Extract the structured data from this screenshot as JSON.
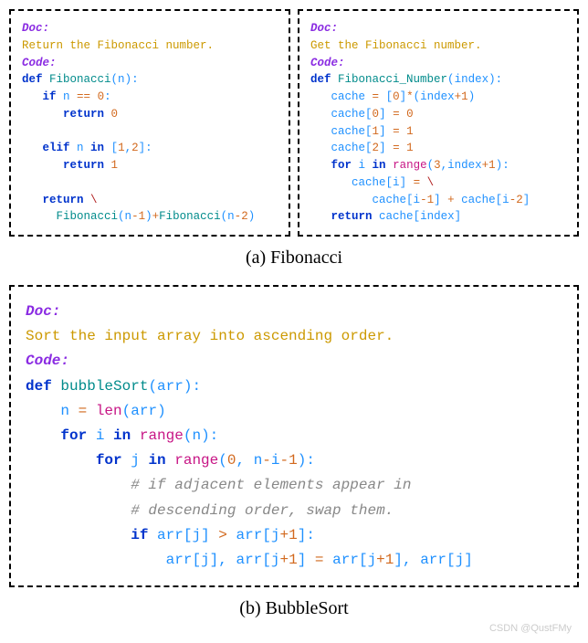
{
  "top": {
    "left": {
      "docLabel": "Doc:",
      "docText": "Return the Fibonacci number.",
      "codeLabel": "Code:",
      "l1_def": "def",
      "l1_fn": " Fibonacci",
      "l1_paren_open": "(",
      "l1_arg": "n",
      "l1_paren_close": "):",
      "l2_if": "if",
      "l2_var": " n ",
      "l2_eq": "==",
      "l2_sp": " ",
      "l2_zero": "0",
      "l2_colon": ":",
      "l3_ret": "return",
      "l3_sp": " ",
      "l3_zero": "0",
      "l4_elif": "elif",
      "l4_var": " n ",
      "l4_in": "in",
      "l4_sp": " ",
      "l4_lb": "[",
      "l4_one": "1",
      "l4_comma": ",",
      "l4_two": "2",
      "l4_rb": "]:",
      "l5_ret": "return",
      "l5_sp": " ",
      "l5_one": "1",
      "l6_ret": "return",
      "l6_sp": " ",
      "l6_bs": "\\",
      "l7_fn1": "Fibonacci",
      "l7_p1o": "(",
      "l7_v1": "n",
      "l7_m1": "-",
      "l7_n1": "1",
      "l7_p1c": ")",
      "l7_plus": "+",
      "l7_fn2": "Fibonacci",
      "l7_p2o": "(",
      "l7_v2": "n",
      "l7_m2": "-",
      "l7_n2": "2",
      "l7_p2c": ")"
    },
    "right": {
      "docLabel": "Doc:",
      "docText": "Get the Fibonacci number.",
      "codeLabel": "Code:",
      "l1_def": "def",
      "l1_fn": " Fibonacci_Number",
      "l1_po": "(",
      "l1_arg": "index",
      "l1_pc": "):",
      "l2_var": "cache ",
      "l2_eq": "=",
      "l2_sp": " ",
      "l2_lb": "[",
      "l2_zero": "0",
      "l2_rb": "]",
      "l2_star": "*",
      "l2_po": "(",
      "l2_idx": "index",
      "l2_plus": "+",
      "l2_one": "1",
      "l2_pc": ")",
      "l3_var": "cache",
      "l3_lb": "[",
      "l3_zero": "0",
      "l3_rb": "] ",
      "l3_eq": "=",
      "l3_sp": " ",
      "l3_val": "0",
      "l4_var": "cache",
      "l4_lb": "[",
      "l4_one": "1",
      "l4_rb": "] ",
      "l4_eq": "=",
      "l4_sp": " ",
      "l4_val": "1",
      "l5_var": "cache",
      "l5_lb": "[",
      "l5_two": "2",
      "l5_rb": "] ",
      "l5_eq": "=",
      "l5_sp": " ",
      "l5_val": "1",
      "l6_for": "for",
      "l6_i": " i ",
      "l6_in": "in",
      "l6_sp": " ",
      "l6_range": "range",
      "l6_po": "(",
      "l6_three": "3",
      "l6_comma": ",",
      "l6_idx": "index",
      "l6_plus": "+",
      "l6_one": "1",
      "l6_pc": "):",
      "l7_var": "cache",
      "l7_lb": "[",
      "l7_i": "i",
      "l7_rb": "] ",
      "l7_eq": "=",
      "l7_sp": " ",
      "l7_bs": "\\",
      "l8_v1": "cache",
      "l8_lb1": "[",
      "l8_i1": "i",
      "l8_m1": "-",
      "l8_n1": "1",
      "l8_rb1": "] ",
      "l8_plus": "+",
      "l8_sp": " ",
      "l8_v2": "cache",
      "l8_lb2": "[",
      "l8_i2": "i",
      "l8_m2": "-",
      "l8_n2": "2",
      "l8_rb2": "]",
      "l9_ret": "return",
      "l9_sp": " ",
      "l9_var": "cache",
      "l9_lb": "[",
      "l9_idx": "index",
      "l9_rb": "]"
    }
  },
  "captionA": "(a) Fibonacci",
  "bottom": {
    "docLabel": "Doc:",
    "docText": "Sort the input array into ascending order.",
    "codeLabel": "Code:",
    "l1_def": "def",
    "l1_fn": " bubbleSort",
    "l1_po": "(",
    "l1_arg": "arr",
    "l1_pc": "):",
    "l2_var": "n ",
    "l2_eq": "=",
    "l2_sp": " ",
    "l2_len": "len",
    "l2_po": "(",
    "l2_arr": "arr",
    "l2_pc": ")",
    "l3_for": "for",
    "l3_i": " i ",
    "l3_in": "in",
    "l3_sp": " ",
    "l3_range": "range",
    "l3_po": "(",
    "l3_n": "n",
    "l3_pc": "):",
    "l4_for": "for",
    "l4_j": " j ",
    "l4_in": "in",
    "l4_sp": " ",
    "l4_range": "range",
    "l4_po": "(",
    "l4_zero": "0",
    "l4_comma": ", ",
    "l4_n": "n",
    "l4_m1": "-",
    "l4_i": "i",
    "l4_m2": "-",
    "l4_one": "1",
    "l4_pc": "):",
    "l5_cmt": "# if adjacent elements appear in",
    "l6_cmt": "# descending order, swap them.",
    "l7_if": "if",
    "l7_sp": " ",
    "l7_a1": "arr",
    "l7_lb1": "[",
    "l7_j1": "j",
    "l7_rb1": "] ",
    "l7_gt": ">",
    "l7_sp2": " ",
    "l7_a2": "arr",
    "l7_lb2": "[",
    "l7_j2": "j",
    "l7_plus": "+",
    "l7_one": "1",
    "l7_rb2": "]:",
    "l8_a1": "arr",
    "l8_lb1": "[",
    "l8_j1": "j",
    "l8_rb1": "], ",
    "l8_a2": "arr",
    "l8_lb2": "[",
    "l8_j2": "j",
    "l8_plus2": "+",
    "l8_one2": "1",
    "l8_rb2": "] ",
    "l8_eq": "=",
    "l8_sp": " ",
    "l8_a3": "arr",
    "l8_lb3": "[",
    "l8_j3": "j",
    "l8_plus3": "+",
    "l8_one3": "1",
    "l8_rb3": "], ",
    "l8_a4": "arr",
    "l8_lb4": "[",
    "l8_j4": "j",
    "l8_rb4": "]"
  },
  "captionB": "(b) BubbleSort",
  "watermark": "CSDN @QustFMy"
}
